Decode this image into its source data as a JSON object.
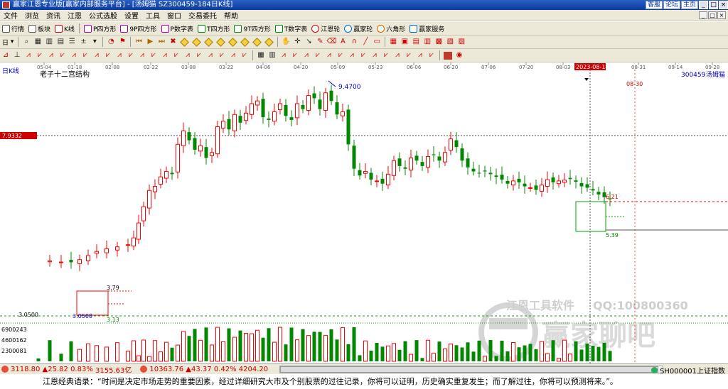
{
  "window": {
    "title": "赢家江恩专业版[赢家内部服务平台] - [汤姆猫  SZ300459-184日K线]",
    "links": [
      "客服",
      "论坛",
      "主页"
    ],
    "controls": [
      "_",
      "□",
      "×"
    ]
  },
  "menu": [
    "文件",
    "浏览",
    "资讯",
    "江恩",
    "公式选股",
    "设置",
    "工具",
    "窗口",
    "交易委托",
    "帮助"
  ],
  "toolbar1": [
    "行情",
    "板块",
    "K线",
    "P四方形",
    "9P四方形",
    "P数字表",
    "T四方形",
    "9T四方形",
    "T数字表",
    "江恩轮",
    "赢家轮",
    "六角形",
    "赢家服务"
  ],
  "toolbar2_first": "日",
  "chart": {
    "period_label": "日K线",
    "indicator_label": "老子十二宫结构",
    "code": "300459",
    "name": "汤姆猫",
    "cursor_date": "2023-08-14",
    "crosshair_price_label": "7.9332",
    "cursor_price_label": "3.0500",
    "x_ticks": [
      "05-04",
      "01-18",
      "02-08",
      "02-22",
      "03-08",
      "03-22",
      "04-06",
      "04-20",
      "05-09",
      "05-23",
      "06-06",
      "06-20",
      "07-06",
      "07-20",
      "08-03",
      "08-31",
      "09-14",
      "09-28"
    ],
    "annotations": {
      "high": "9.4700",
      "box1_top": "3.79",
      "box1_bottom": "3.13",
      "low": "3.0500",
      "box2_top": "6.21",
      "box2_bottom": "5.39",
      "future_date": "08-30"
    },
    "volume_labels": [
      "6900243",
      "4600162",
      "2300081"
    ],
    "watermark": {
      "text1": "江恩工具软件",
      "text2": "QQ:100800360",
      "brand": "赢家聊吧"
    },
    "colors": {
      "up": "#ff0000",
      "down": "#008800",
      "box": "#ff0000",
      "greenbox": "#00aa00"
    }
  },
  "statusbar": {
    "idx1_value": "3118.80",
    "idx1_change": "▲25.82",
    "idx1_pct": "0.83%",
    "idx1_amount": "3155.63亿",
    "idx2_value": "10363.76",
    "idx2_change": "▲43.37",
    "idx2_pct": "0.42%",
    "idx2_amount": "4204.20",
    "right_label": "SH000001上证指数"
  },
  "quote": "江恩经典语录：“时间是决定市场走势的重要因素，经过详细研究大市及个别股票的过往记录，你将可以证明，历史确实重复发生；而了解过往，你将可以预测将来。”。"
}
